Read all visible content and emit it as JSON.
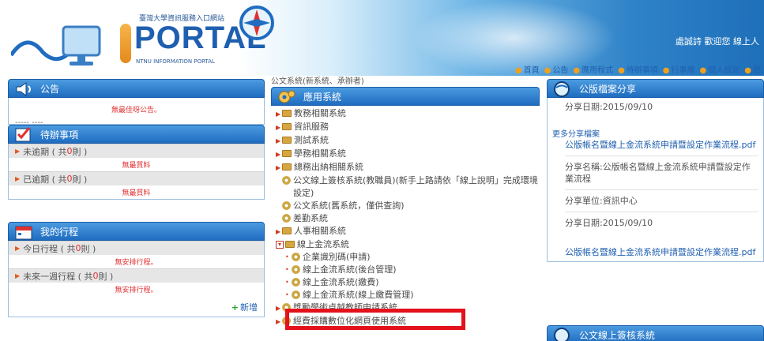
{
  "header": {
    "subtitle": "臺灣大學資訊服務入口網站",
    "logo_text": "PORTAL",
    "tagline": "NTNU INFORMATION PORTAL",
    "welcome": "處誠詩 歡迎您 線上人",
    "nav": [
      "首頁",
      "公告",
      "應用程式",
      "待辦事項",
      "行事曆",
      "個人設定",
      "登"
    ]
  },
  "left": {
    "news": {
      "title": "公告",
      "empty": "無最佳呀公告。",
      "clip": "-----  ----"
    },
    "todo": {
      "title": "待辦事項",
      "rows": [
        {
          "label": "未逾期 ( 共 ",
          "count": "0",
          "suffix": " 則 )",
          "empty": "無最質料"
        },
        {
          "label": "已逾期 ( 共 ",
          "count": "0",
          "suffix": " 則 )",
          "empty": "無最質料"
        }
      ]
    },
    "schedule": {
      "title": "我的行程",
      "rows": [
        {
          "label": "今日行程 ( 共 ",
          "count": "0",
          "suffix": " 則 )",
          "empty": "無安排行程。"
        },
        {
          "label": "未來一週行程 ( 共 ",
          "count": "0",
          "suffix": " 則 )",
          "empty": "無安排行程。"
        }
      ],
      "add": "新增"
    }
  },
  "middle": {
    "cutoff_top": "公文系統(新系統、承辦者)",
    "title": "應用系統",
    "items": [
      {
        "type": "folder",
        "label": "教務相關系統"
      },
      {
        "type": "folder",
        "label": "資訊服務"
      },
      {
        "type": "folder",
        "label": "測試系統"
      },
      {
        "type": "folder",
        "label": "學務相關系統"
      },
      {
        "type": "folder",
        "label": "總務出納相關系統"
      },
      {
        "type": "gear",
        "label": "公文線上簽核系統(教職員)(新手上路請依「線上說明」完成環境設定)"
      },
      {
        "type": "gear",
        "label": "公文系統(舊系統，僅供查詢)"
      },
      {
        "type": "gear",
        "label": "差勤系統"
      },
      {
        "type": "folder",
        "label": "人事相關系統"
      },
      {
        "type": "open-folder",
        "label": "線上金流系統"
      },
      {
        "type": "sub-gear",
        "label": "企業識別碼(申請)"
      },
      {
        "type": "sub-gear",
        "label": "線上金流系統(後台管理)"
      },
      {
        "type": "sub-gear",
        "label": "線上金流系統(繳費)"
      },
      {
        "type": "sub-gear",
        "label": "線上金流系統(線上繳費管理)"
      },
      {
        "type": "gear",
        "label": "獎勵學術卓越教師申請系統"
      },
      {
        "type": "gear",
        "label": "經費採購數位化網頁使用系統"
      }
    ]
  },
  "right": {
    "title": "公版檔案分享",
    "share_date_1": "分享日期:2015/09/10",
    "more": "更多分享檔案",
    "pdf_1": "公版帳名暨線上金流系統申請暨設定作業流程.pdf",
    "name_label": "分享名稱:公版帳名暨線上金流系統申請暨設定作業流程",
    "unit": "分享單位:資訊中心",
    "share_date_2": "分享日期:2015/09/10",
    "pdf_2": "公版帳名暨線上金流系統申請暨設定作業流程.pdf",
    "next_title": "公文線上簽核系統"
  }
}
